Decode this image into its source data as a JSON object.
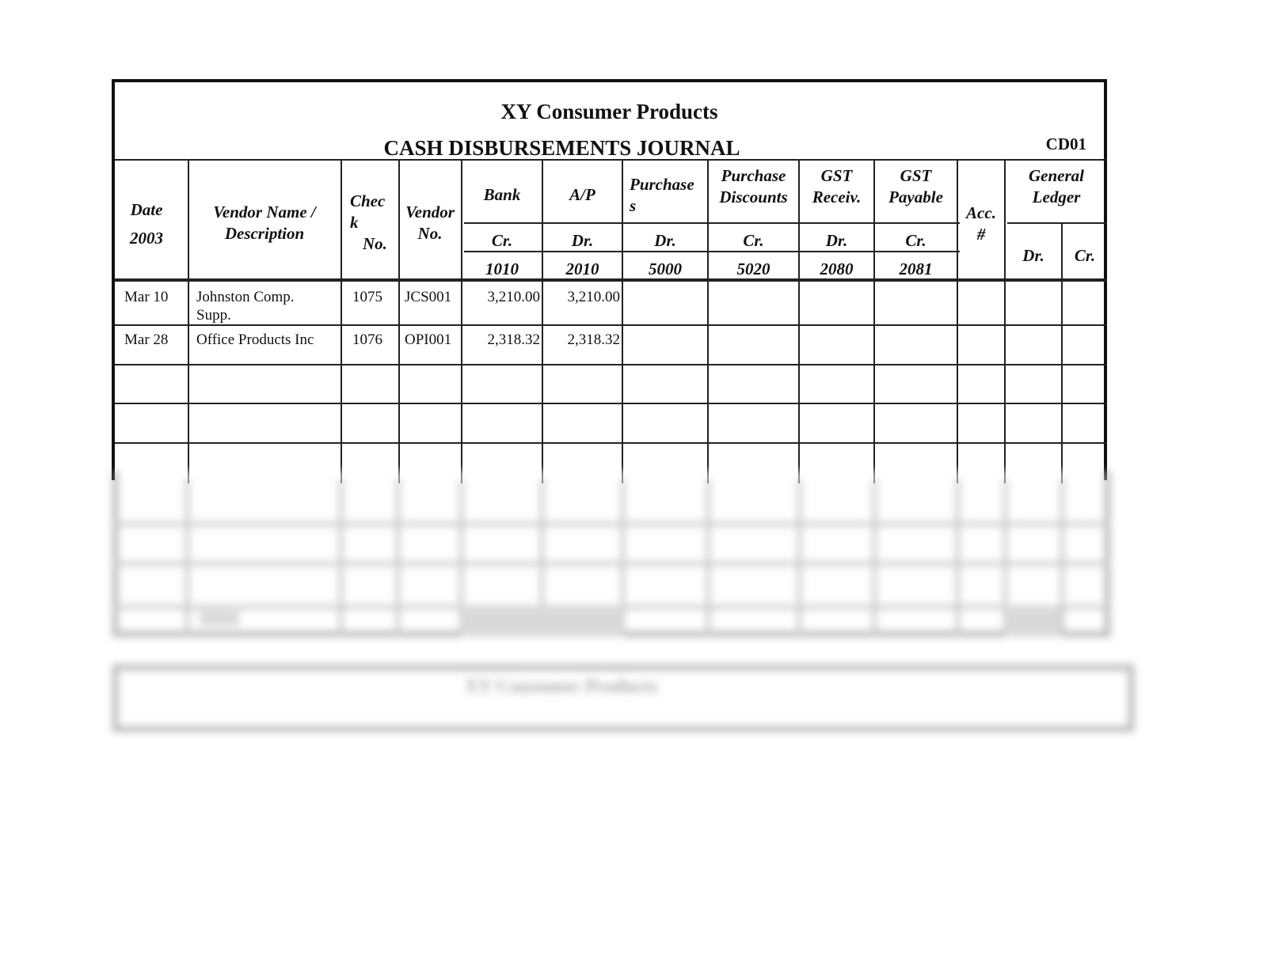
{
  "document": {
    "company": "XY Consumer Products",
    "journal_title": "CASH DISBURSEMENTS JOURNAL",
    "journal_code": "CD01"
  },
  "headers": {
    "date": [
      "Date",
      "2003"
    ],
    "vendor_name": [
      "Vendor Name /",
      "Description"
    ],
    "check_no": [
      "Chec",
      "k",
      "No."
    ],
    "vendor_no": [
      "Vendor",
      "No."
    ],
    "bank": {
      "label": "Bank",
      "side": "Cr.",
      "account": "1010"
    },
    "ap": {
      "label": "A/P",
      "side": "Dr.",
      "account": "2010"
    },
    "purchases": {
      "label": [
        "Purchase",
        "s"
      ],
      "side": "Dr.",
      "account": "5000"
    },
    "purchase_discounts": {
      "label": [
        "Purchase",
        "Discounts"
      ],
      "side": "Cr.",
      "account": "5020"
    },
    "gst_receiv": {
      "label": [
        "GST",
        "Receiv."
      ],
      "side": "Dr.",
      "account": "2080"
    },
    "gst_payable": {
      "label": [
        "GST",
        "Payable"
      ],
      "side": "Cr.",
      "account": "2081"
    },
    "acc_no": [
      "Acc.",
      "#"
    ],
    "general_ledger": {
      "label": [
        "General",
        "Ledger"
      ],
      "dr": "Dr.",
      "cr": "Cr."
    }
  },
  "rows": [
    {
      "date": "Mar 10",
      "vendor": [
        "Johnston Comp.",
        "Supp."
      ],
      "check_no": "1075",
      "vendor_no": "JCS001",
      "bank_cr": "3,210.00",
      "ap_dr": "3,210.00"
    },
    {
      "date": "Mar 28",
      "vendor": [
        "Office Products Inc",
        ""
      ],
      "check_no": "1076",
      "vendor_no": "OPI001",
      "bank_cr": "2,318.32",
      "ap_dr": "2,318.32"
    }
  ],
  "blurred_preview": {
    "second_table_title": "XY Consumer Products"
  }
}
